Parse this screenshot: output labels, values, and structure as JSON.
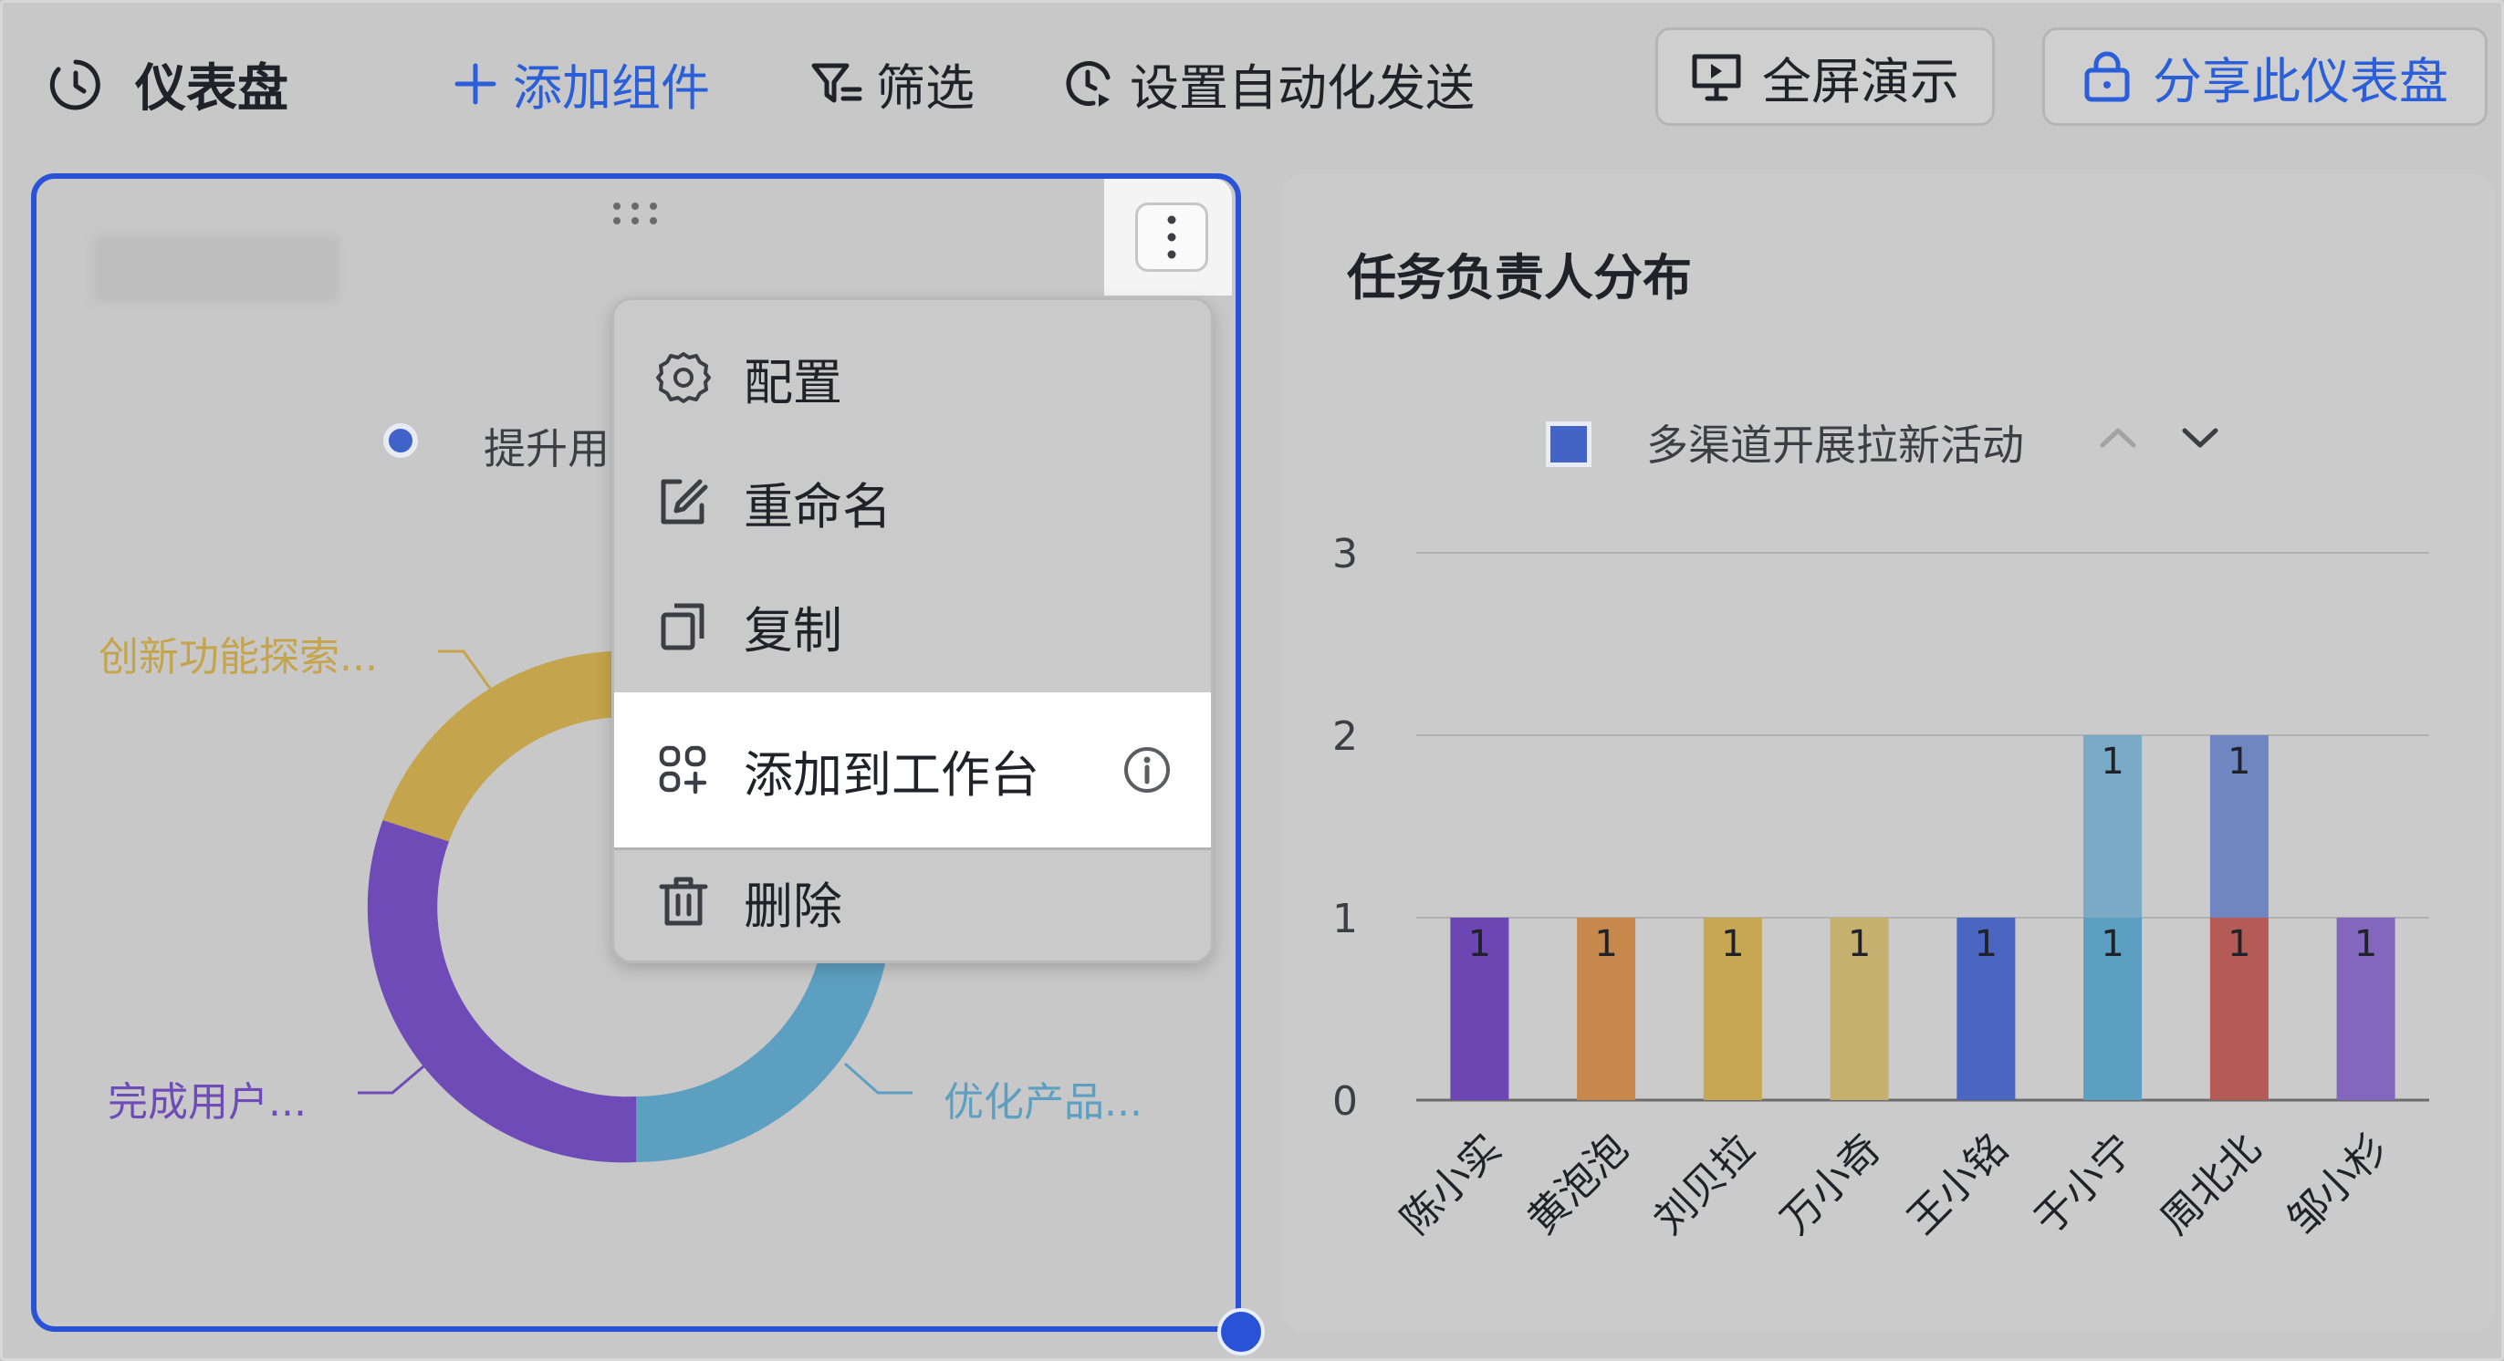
{
  "toolbar": {
    "title": "仪表盘",
    "add_widget": "添加组件",
    "filter": "筛选",
    "auto_send": "设置自动化发送",
    "fullscreen": "全屏演示",
    "share": "分享此仪表盘"
  },
  "left_card": {
    "legend_label": "提升用",
    "slices": [
      {
        "label": "创新功能探索...",
        "color": "#c4a44c"
      },
      {
        "label": "完成用户...",
        "color": "#6f4bb8"
      },
      {
        "label": "优化产品...",
        "color": "#5d9fc0"
      }
    ]
  },
  "menu": {
    "items": [
      {
        "label": "配置",
        "icon": "gear-icon"
      },
      {
        "label": "重命名",
        "icon": "edit-icon"
      },
      {
        "label": "复制",
        "icon": "copy-icon"
      },
      {
        "label": "添加到工作台",
        "icon": "workspace-icon"
      },
      {
        "label": "删除",
        "icon": "trash-icon"
      }
    ]
  },
  "right_card": {
    "title": "任务负责人分布",
    "legend_label": "多渠道开展拉新活动"
  },
  "chart_data": {
    "type": "bar",
    "stacked": true,
    "categories": [
      "陈小实",
      "黄泡泡",
      "刘贝拉",
      "万小奇",
      "王小铭",
      "于小宁",
      "周北北",
      "邹小杉"
    ],
    "ylim": [
      0,
      3
    ],
    "yticks": [
      0,
      1,
      2,
      3
    ],
    "series": [
      {
        "values": [
          1,
          1,
          1,
          1,
          1,
          1,
          1,
          1
        ],
        "colors": [
          "#6c46b3",
          "#c6884b",
          "#c7a754",
          "#c6b070",
          "#4b66c1",
          "#5c9fc1",
          "#b55b56",
          "#8366be"
        ]
      },
      {
        "values": [
          0,
          0,
          0,
          0,
          0,
          1,
          1,
          0
        ],
        "colors": [
          "#6c46b3",
          "#c6884b",
          "#c7a754",
          "#c6b070",
          "#4b66c1",
          "#7aaac5",
          "#6f86c2",
          "#8366be"
        ]
      }
    ],
    "legend_position": "top",
    "grid": true
  }
}
